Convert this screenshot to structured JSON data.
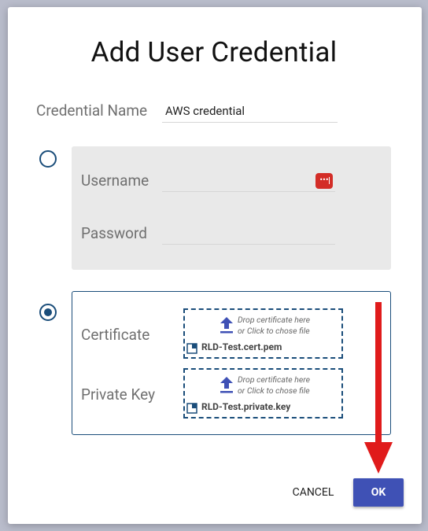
{
  "dialog": {
    "title": "Add User Credential",
    "credential_name": {
      "label": "Credential Name",
      "value": "AWS credential"
    },
    "password_option": {
      "selected": false,
      "username_label": "Username",
      "password_label": "Password",
      "lastpass_glyph": "•••"
    },
    "certificate_option": {
      "selected": true,
      "certificate_label": "Certificate",
      "private_key_label": "Private Key",
      "certificate_drop": {
        "hint_line1": "Drop certificate here",
        "hint_line2": "or Click to chose file",
        "file_name": "RLD-Test.cert.pem"
      },
      "private_key_drop": {
        "hint_line1": "Drop certificate here",
        "hint_line2": "or Click to chose file",
        "file_name": "RLD-Test.private.key"
      }
    },
    "buttons": {
      "cancel": "CANCEL",
      "ok": "OK"
    }
  },
  "colors": {
    "accent": "#1a4d7a",
    "ok_button": "#3f51b5",
    "annotation_arrow": "#e01b1b",
    "upload_icon": "#3f51b5"
  }
}
